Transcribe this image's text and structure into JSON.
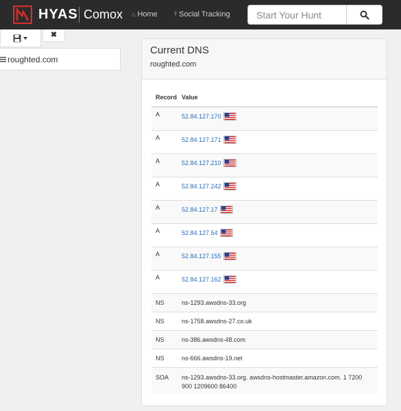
{
  "navbar": {
    "brand": "HYAS",
    "product": "Comox",
    "links": [
      {
        "label": "Home",
        "icon": "home-icon"
      },
      {
        "label": "Social Tracking",
        "icon": "pin-icon"
      }
    ],
    "search_placeholder": "Start Your Hunt",
    "brand_color": "#d32f2f"
  },
  "sidebar": {
    "domain": "roughted.com",
    "close_symbol": "✖"
  },
  "panel": {
    "title": "Current DNS",
    "domain": "roughted.com"
  },
  "dns_table": {
    "headers": [
      "Record",
      "Value"
    ],
    "rows": [
      {
        "record": "A",
        "value": "52.84.127.170",
        "flag": "us-flag"
      },
      {
        "record": "A",
        "value": "52.84.127.171",
        "flag": "us-flag"
      },
      {
        "record": "A",
        "value": "52.84.127.210",
        "flag": "us-flag"
      },
      {
        "record": "A",
        "value": "52.84.127.242",
        "flag": "us-flag"
      },
      {
        "record": "A",
        "value": "52.84.127.17",
        "flag": "us-flag"
      },
      {
        "record": "A",
        "value": "52.84.127.54",
        "flag": "us-flag"
      },
      {
        "record": "A",
        "value": "52.84.127.155",
        "flag": "us-flag"
      },
      {
        "record": "A",
        "value": "52.84.127.162",
        "flag": "us-flag"
      },
      {
        "record": "NS",
        "value": "ns-1293.awsdns-33.org"
      },
      {
        "record": "NS",
        "value": "ns-1758.awsdns-27.co.uk"
      },
      {
        "record": "NS",
        "value": "ns-386.awsdns-48.com"
      },
      {
        "record": "NS",
        "value": "ns-666.awsdns-19.net"
      },
      {
        "record": "SOA",
        "value": "ns-1293.awsdns-33.org. awsdns-hostmaster.amazon.com. 1 7200 900 1209600 86400"
      }
    ]
  }
}
